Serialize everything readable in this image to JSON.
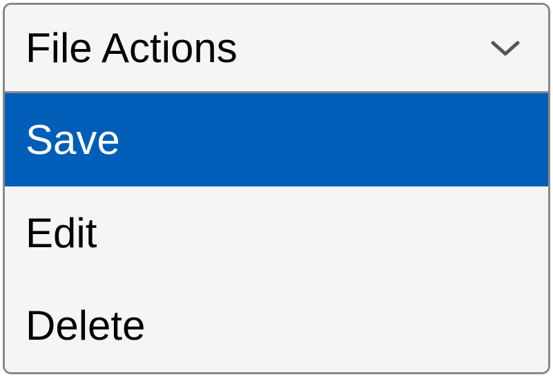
{
  "dropdown": {
    "label": "File Actions",
    "expanded": true,
    "highlighted_index": 0,
    "items": [
      {
        "id": "save",
        "label": "Save"
      },
      {
        "id": "edit",
        "label": "Edit"
      },
      {
        "id": "delete",
        "label": "Delete"
      }
    ],
    "colors": {
      "highlight_bg": "#005eb8",
      "highlight_fg": "#ffffff",
      "border": "#888888",
      "bg": "#f5f5f5"
    }
  }
}
